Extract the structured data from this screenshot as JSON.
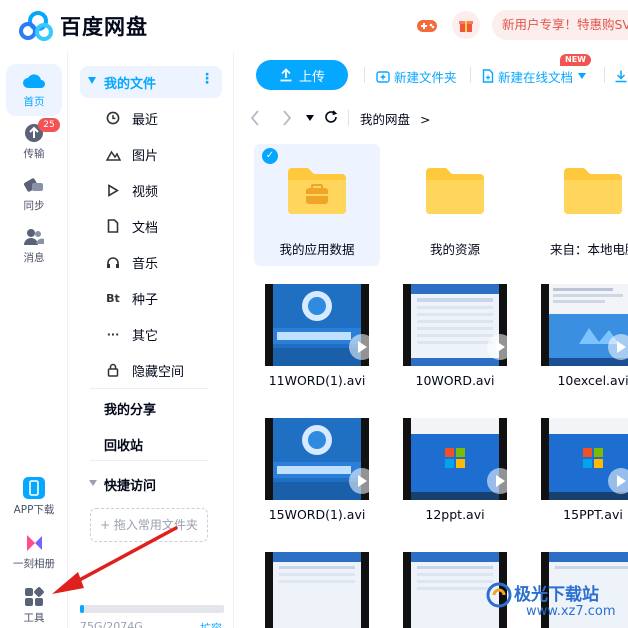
{
  "header": {
    "brand": "百度网盘",
    "promo": "新用户专享！特惠购SVI"
  },
  "rail": {
    "items": [
      {
        "label": "首页",
        "active": true
      },
      {
        "label": "传输",
        "badge": "25"
      },
      {
        "label": "同步"
      },
      {
        "label": "消息"
      }
    ],
    "bottom": [
      {
        "label": "APP下载"
      },
      {
        "label": "一刻相册"
      },
      {
        "label": "工具"
      }
    ]
  },
  "sidebar": {
    "my_files": "我的文件",
    "more": "⋮",
    "items": [
      {
        "label": "最近",
        "icon": "clock-icon"
      },
      {
        "label": "图片",
        "icon": "image-icon"
      },
      {
        "label": "视频",
        "icon": "play-icon"
      },
      {
        "label": "文档",
        "icon": "document-icon"
      },
      {
        "label": "音乐",
        "icon": "headphones-icon"
      },
      {
        "label": "种子",
        "icon": "bt-icon",
        "glyph": "Bt"
      },
      {
        "label": "其它",
        "icon": "ellipsis-icon",
        "glyph": "···"
      },
      {
        "label": "隐藏空间",
        "icon": "lock-icon"
      }
    ],
    "my_share": "我的分享",
    "recycle": "回收站",
    "quick_access": "快捷访问",
    "drop_hint": "+ 拖入常用文件夹",
    "storage_text": "75G/2074G",
    "expand": "扩容"
  },
  "toolbar": {
    "upload": "上传",
    "new_folder": "新建文件夹",
    "new_online_doc": "新建在线文档",
    "new_tag": "NEW"
  },
  "nav": {
    "breadcrumb": "我的网盘",
    "sep": ">"
  },
  "folders": [
    {
      "name": "我的应用数据",
      "selected": true
    },
    {
      "name": "我的资源"
    },
    {
      "name": "来自：本地电脑"
    }
  ],
  "videos": [
    {
      "name": "11WORD(1).avi",
      "style": "blue"
    },
    {
      "name": "10WORD.avi",
      "style": "table"
    },
    {
      "name": "10excel.avi",
      "style": "desktop"
    },
    {
      "name": "15WORD(1).avi",
      "style": "blue"
    },
    {
      "name": "12ppt.avi",
      "style": "win7"
    },
    {
      "name": "15PPT.avi",
      "style": "win7"
    }
  ],
  "watermark": {
    "text": "极光下载站",
    "url": "www.xz7.com"
  },
  "colors": {
    "accent": "#06a7ff",
    "badge": "#f35353",
    "folder": "#ffc83d",
    "arrow": "#e0201d"
  }
}
